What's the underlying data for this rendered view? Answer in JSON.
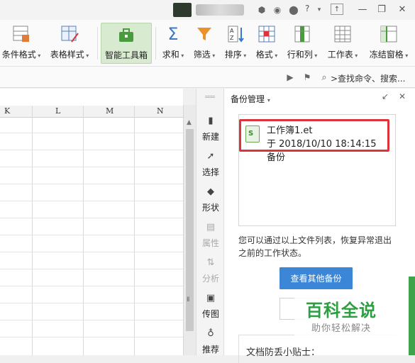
{
  "titlebar": {
    "help": "?"
  },
  "ribbon": {
    "items": [
      {
        "label": "条件格式"
      },
      {
        "label": "表格样式"
      },
      {
        "label": "智能工具箱"
      },
      {
        "label": "求和"
      },
      {
        "label": "筛选"
      },
      {
        "label": "排序"
      },
      {
        "label": "格式"
      },
      {
        "label": "行和列"
      },
      {
        "label": "工作表"
      },
      {
        "label": "冻结窗格"
      }
    ]
  },
  "search": {
    "text": ">查找命令、搜索..."
  },
  "columns": [
    "K",
    "L",
    "M",
    "N"
  ],
  "sidetools": [
    {
      "label": "新建"
    },
    {
      "label": "选择"
    },
    {
      "label": "形状"
    },
    {
      "label": "属性"
    },
    {
      "label": "分析"
    },
    {
      "label": "传图"
    },
    {
      "label": "推荐"
    }
  ],
  "panel": {
    "title": "备份管理",
    "file": {
      "name": "工作簿1.et",
      "date": "于 2018/10/10 18:14:15 备份"
    },
    "description": "您可以通过以上文件列表，恢复异常退出之前的工作状态。",
    "more_button": "查看其他备份",
    "tips_title": "文档防丢小贴士："
  },
  "watermark": {
    "title": "百科全说",
    "subtitle": "助你轻松解决"
  },
  "colors": {
    "accent": "#3b86d6",
    "highlight": "#d9353b",
    "brand": "#2e9e42"
  }
}
